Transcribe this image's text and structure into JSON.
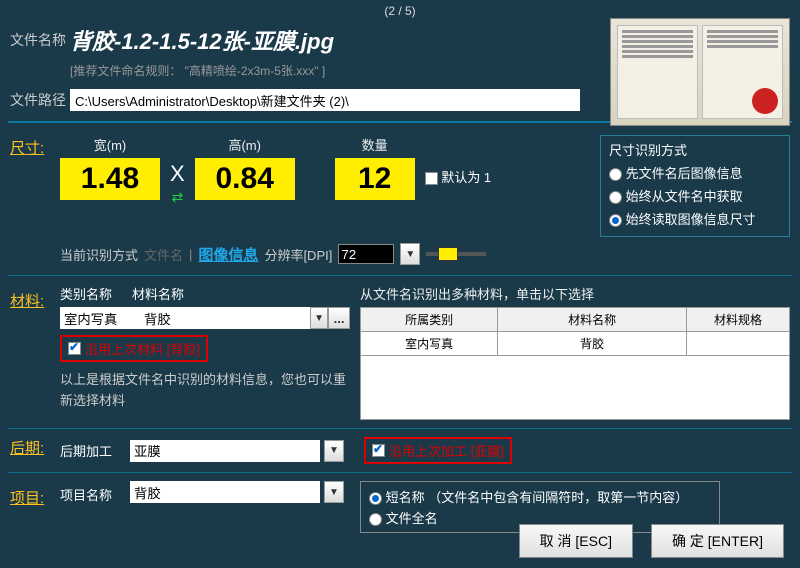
{
  "page_counter": "(2 / 5)",
  "labels": {
    "filename": "文件名称",
    "filepath": "文件路径",
    "size": "尺寸:",
    "material": "材料:",
    "post": "后期:",
    "project": "项目:"
  },
  "filename": "背胶-1.2-1.5-12张-亚膜.jpg",
  "naming_hint": "[推荐文件命名规则：  \"高精喷绘-2x3m-5张.xxx\"  ]",
  "filepath": "C:\\Users\\Administrator\\Desktop\\新建文件夹 (2)\\",
  "size": {
    "width_head": "宽(m)",
    "height_head": "高(m)",
    "qty_head": "数量",
    "width": "1.48",
    "height": "0.84",
    "qty": "12",
    "x": "X",
    "default1": "默认为 1"
  },
  "recog_panel": {
    "title": "尺寸识别方式",
    "opt1": "先文件名后图像信息",
    "opt2": "始终从文件名中获取",
    "opt3": "始终读取图像信息尺寸"
  },
  "recog_row": {
    "cur": "当前识别方式",
    "fname": "文件名",
    "imginfo": "图像信息",
    "dpi_label": "分辨率[DPI]",
    "dpi_value": "72"
  },
  "material": {
    "cat_label": "类别名称",
    "mat_label": "材料名称",
    "cat_value": "室内写真",
    "mat_value": "背胶",
    "dots": "...",
    "reuse": "沿用上次材料 [背胶]",
    "hint": "以上是根据文件名中识别的材料信息，您也可以重新选择材料",
    "right_head": "从文件名识别出多种材料，单击以下选择",
    "col1": "所属类别",
    "col2": "材料名称",
    "col3": "材料规格",
    "row_cat": "室内写真",
    "row_mat": "背胶",
    "row_spec": ""
  },
  "post": {
    "label": "后期加工",
    "value": "亚膜",
    "reuse": "沿用上次加工 [亚膜]"
  },
  "project": {
    "label": "项目名称",
    "value": "背胶",
    "opt1": "短名称    （文件名中包含有间隔符时，取第一节内容）",
    "opt2": "文件全名"
  },
  "buttons": {
    "cancel": "取 消  [ESC]",
    "ok": "确 定  [ENTER]"
  }
}
